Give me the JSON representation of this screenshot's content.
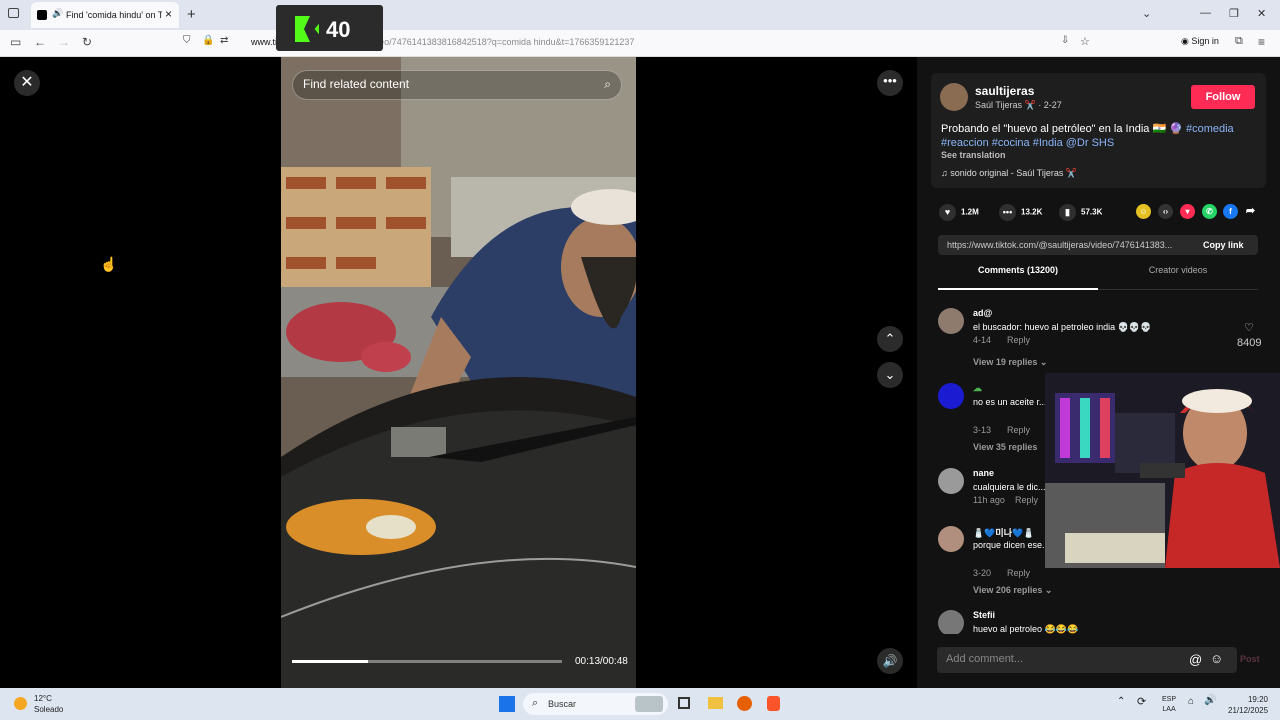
{
  "browser": {
    "tab_title": "Find 'comida hindu' on TikTok",
    "new_tab": "+",
    "url_domain": "www.tiktok.com",
    "url_rest": "/@saultijeras/video/7476141383816842518?q=comida hindu&t=1766359121237",
    "sign_in": "Sign in"
  },
  "kick_overlay": {
    "count": "40"
  },
  "video": {
    "search_placeholder": "Find related content",
    "time": "00:13/00:48",
    "progress_fraction": 0.28
  },
  "post": {
    "username": "saultijeras",
    "display_name": "Saúl Tijeras",
    "date": "2-27",
    "follow_label": "Follow",
    "description": "Probando el \"huevo al petróleo\" en la India 🇮🇳 🔮",
    "tags_line1": "#comedia",
    "tags_line2": "#reaccion #cocina #India @Dr SHS",
    "see_translation": "See translation",
    "sound": "sonido original - Saúl Tijeras"
  },
  "stats": {
    "likes": "1.2M",
    "comments": "13.2K",
    "saves": "57.3K"
  },
  "link": {
    "url": "https://www.tiktok.com/@saultijeras/video/7476141383...",
    "copy_label": "Copy link"
  },
  "tabs": {
    "comments": "Comments (13200)",
    "creator": "Creator videos"
  },
  "comments": [
    {
      "name": "ad@",
      "text": "el buscador: huevo al petroleo india 💀💀💀",
      "date": "4-14",
      "reply": "Reply",
      "view_replies": "View 19 replies",
      "likes": "8409"
    },
    {
      "name": "",
      "text": "no es un aceite r... e de mostaza\" q...",
      "date": "3-13",
      "reply": "Reply",
      "view_replies": "View 35 replies"
    },
    {
      "name": "nane",
      "text": "cualquiera le dic...",
      "date": "11h ago",
      "reply": "Reply"
    },
    {
      "name": "🧂💙미나💙🧂",
      "text": "porque dicen ese... do desde el cielo...",
      "date": "3-20",
      "reply": "Reply",
      "view_replies": "View 206 replies"
    },
    {
      "name": "Stefii",
      "text": "huevo al petroleo 😂😂😂"
    }
  ],
  "comment_input": {
    "placeholder": "Add comment...",
    "post_label": "Post"
  },
  "taskbar": {
    "temp": "12°C",
    "condition": "Soleado",
    "search": "Buscar",
    "lang_line1": "ESP",
    "lang_line2": "LAA",
    "time": "19:20",
    "date": "21/12/2025"
  },
  "colors": {
    "follow": "#fe2c55",
    "kick_green": "#53fc18",
    "panel_bg": "#121212"
  }
}
